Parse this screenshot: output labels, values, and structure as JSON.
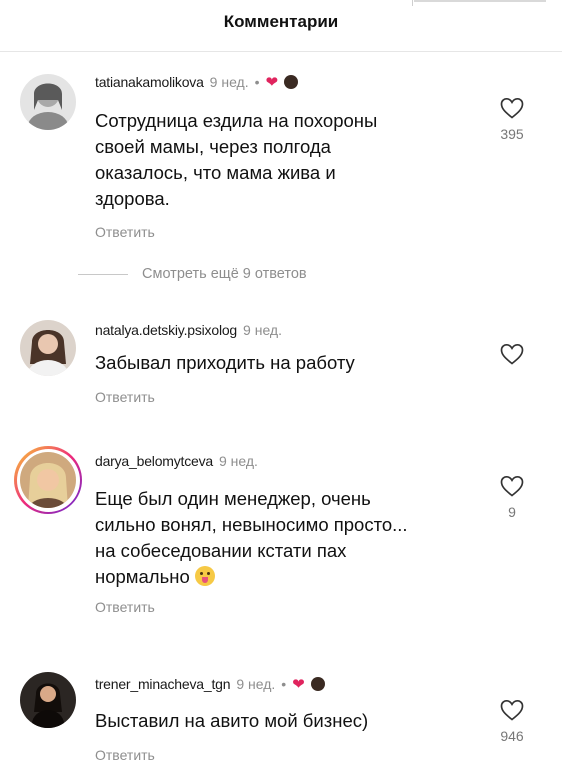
{
  "header": {
    "title": "Комментарии"
  },
  "comments": [
    {
      "username": "tatianakamolikova",
      "time": "9 нед.",
      "liked_by_author": true,
      "text_lines": [
        "Сотрудница ездила на похороны",
        "своей мамы, через полгода",
        "оказалось, что мама жива и",
        "здорова."
      ],
      "reply_label": "Ответить",
      "like_count": "395"
    },
    {
      "username": "natalya.detskiy.psixolog",
      "time": "9 нед.",
      "liked_by_author": false,
      "text_lines": [
        "Забывал приходить на работу"
      ],
      "reply_label": "Ответить",
      "like_count": ""
    },
    {
      "username": "darya_belomytceva",
      "time": "9 нед.",
      "liked_by_author": false,
      "has_story_ring": true,
      "text_lines": [
        "Еще был один менеджер, очень",
        "сильно вонял, невыносимо просто...",
        "на собеседовании кстати пах",
        "нормально"
      ],
      "reply_label": "Ответить",
      "like_count": "9"
    },
    {
      "username": "trener_minacheva_tgn",
      "time": "9 нед.",
      "liked_by_author": true,
      "text_lines": [
        "Выставил на авито мой бизнес)"
      ],
      "reply_label": "Ответить",
      "like_count": "946"
    }
  ],
  "view_more_replies": "Смотреть ещё 9 ответов",
  "icons": {
    "like": "heart-outline-icon",
    "author_like": "red-heart-icon",
    "emoji": "face-with-tongue-emoji"
  },
  "colors": {
    "muted": "#8e8e8e",
    "heart_red": "#e0245e",
    "story_ring": "#d62976"
  }
}
